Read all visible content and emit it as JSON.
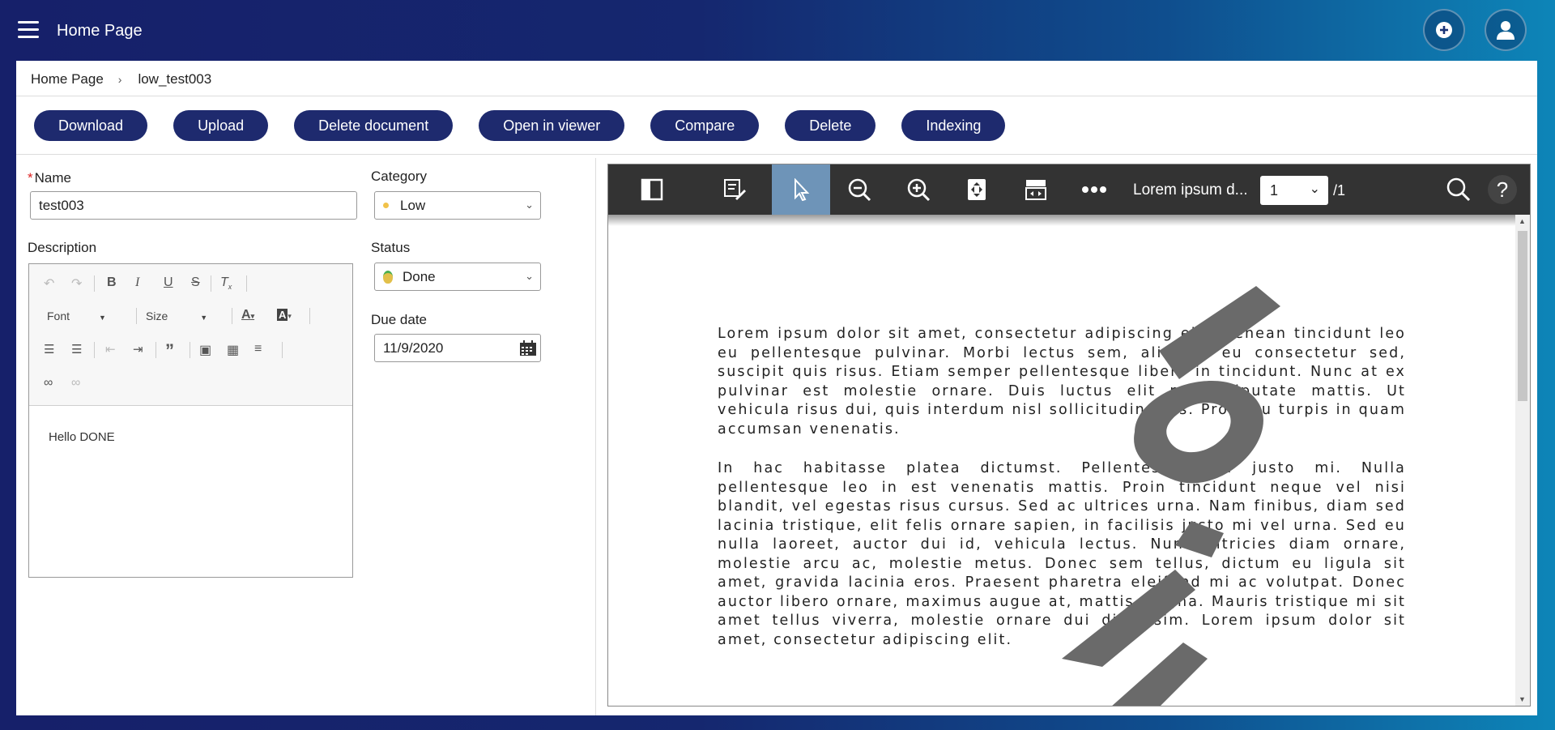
{
  "header": {
    "title": "Home Page"
  },
  "breadcrumb": {
    "home": "Home Page",
    "current": "low_test003"
  },
  "actions": [
    "Download",
    "Upload",
    "Delete document",
    "Open in viewer",
    "Compare",
    "Delete",
    "Indexing"
  ],
  "form": {
    "name_label": "Name",
    "name_value": "test003",
    "description_label": "Description",
    "category_label": "Category",
    "category_value": "Low",
    "status_label": "Status",
    "status_value": "Done",
    "due_label": "Due date",
    "due_value": "11/9/2020"
  },
  "editor": {
    "font_label": "Font",
    "size_label": "Size",
    "content": "Hello DONE"
  },
  "viewer": {
    "doc_name": "Lorem ipsum d...",
    "page": "1",
    "total": "/1",
    "paragraph1": "Lorem ipsum dolor sit amet, consectetur adipiscing elit. Aenean tincidunt leo eu pellentesque pulvinar. Morbi lectus sem, aliquam eu consectetur sed, suscipit quis risus. Etiam semper pellentesque libero in tincidunt. Nunc at ex pulvinar est molestie ornare. Duis luctus elit nec vulputate mattis. Ut vehicula risus dui, quis interdum nisl sollicitudin quis. Proin eu turpis in quam accumsan venenatis.",
    "paragraph2": "In hac habitasse platea dictumst. Pellentesque eu justo mi. Nulla pellentesque leo in est venenatis mattis. Proin tincidunt neque vel nisi blandit, vel egestas risus cursus. Sed ac ultrices urna. Nam finibus, diam sed lacinia tristique, elit felis ornare sapien, in facilisis justo mi vel urna. Sed eu nulla laoreet, auctor dui id, vehicula lectus. Nunc ultricies diam ornare, molestie arcu ac, molestie metus. Donec sem tellus, dictum eu ligula sit amet, gravida lacinia eros. Praesent pharetra eleifend mi ac volutpat. Donec auctor libero ornare, maximus augue at, mattis magna. Mauris tristique mi sit amet tellus viverra, molestie ornare dui dignissim. Lorem ipsum dolor sit amet, consectetur adipiscing elit."
  },
  "colors": {
    "accent": "#1e2a6e",
    "viewer_toolbar": "#333333",
    "active_tool": "#6e94b8"
  }
}
